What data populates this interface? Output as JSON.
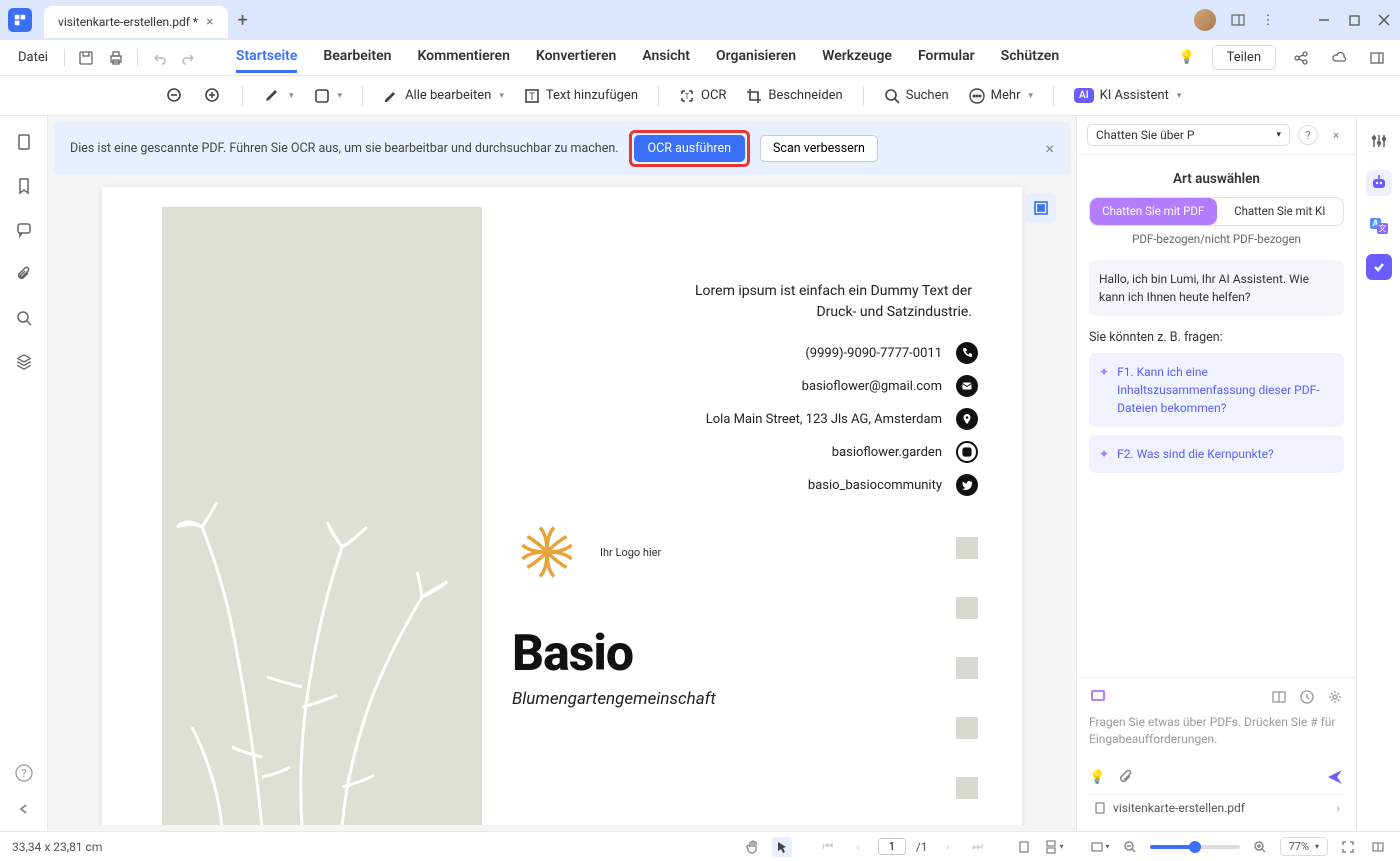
{
  "titlebar": {
    "filename": "visitenkarte-erstellen.pdf *"
  },
  "menu": {
    "file": "Datei",
    "tabs": [
      "Startseite",
      "Bearbeiten",
      "Kommentieren",
      "Konvertieren",
      "Ansicht",
      "Organisieren",
      "Werkzeuge",
      "Formular",
      "Schützen"
    ],
    "share": "Teilen"
  },
  "toolbar": {
    "edit_all": "Alle bearbeiten",
    "add_text": "Text hinzufügen",
    "ocr": "OCR",
    "crop": "Beschneiden",
    "search": "Suchen",
    "more": "Mehr",
    "ai_assistant": "KI Assistent",
    "ai_badge": "AI"
  },
  "ocr_bar": {
    "message": "Dies ist eine gescannte PDF. Führen Sie OCR aus, um sie bearbeitbar und durchsuchbar zu machen.",
    "run": "OCR ausführen",
    "enhance": "Scan verbessern"
  },
  "doc": {
    "desc1": "Lorem ipsum ist einfach ein Dummy Text der",
    "desc2": "Druck- und Satzindustrie.",
    "contacts": [
      "(9999)-9090-7777-0011",
      "basioflower@gmail.com",
      "Lola Main Street, 123 Jls AG, Amsterdam",
      "basioflower.garden",
      "basio_basiocommunity"
    ],
    "logo_hint": "Ihr Logo hier",
    "brand": "Basio",
    "tagline": "Blumengartengemeinschaft"
  },
  "ai": {
    "head_title": "Chatten Sie über P",
    "select_title": "Art auswählen",
    "tab_pdf": "Chatten Sie mit PDF",
    "tab_ai": "Chatten Sie mit KI",
    "subtitle": "PDF-bezogen/nicht PDF-bezogen",
    "greeting": "Hallo, ich bin Lumi, Ihr AI Assistent. Wie kann ich Ihnen heute helfen?",
    "suggest_title": "Sie könnten z. B. fragen:",
    "suggest1": "F1. Kann ich eine Inhaltszusammenfassung dieser PDF-Dateien bekommen?",
    "suggest2": "F2. Was sind die Kernpunkte?",
    "input_hint": "Fragen Sie etwas über PDFs. Drücken Sie # für Eingabeaufforderungen.",
    "file": "visitenkarte-erstellen.pdf"
  },
  "status": {
    "dimensions": "33,34 x 23,81 cm",
    "page_current": "1",
    "page_total": "/1",
    "zoom": "77%"
  }
}
